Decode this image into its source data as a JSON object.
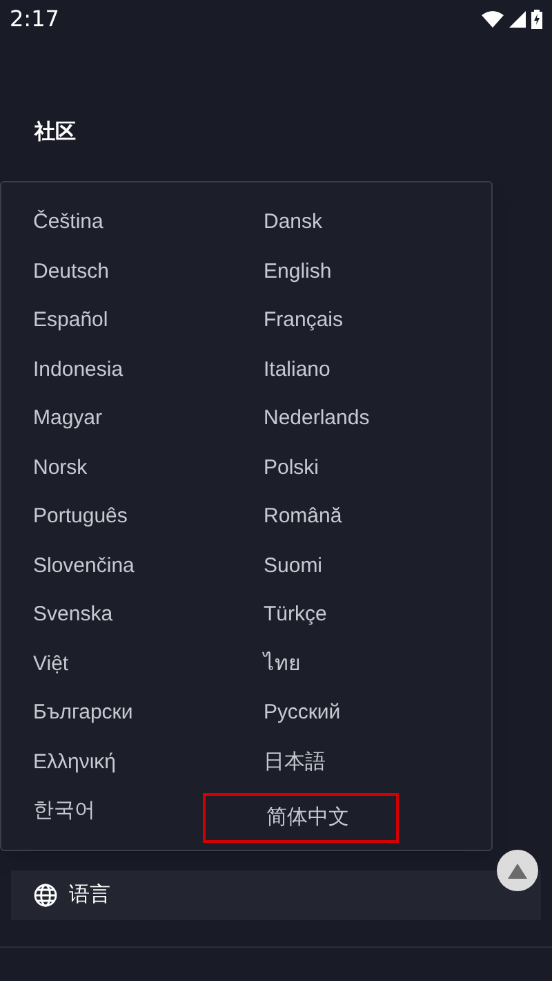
{
  "status_bar": {
    "time": "2:17"
  },
  "section": {
    "title": "社区"
  },
  "language_menu": {
    "options": [
      {
        "label": "Čeština",
        "selected": false
      },
      {
        "label": "Dansk",
        "selected": false
      },
      {
        "label": "Deutsch",
        "selected": false
      },
      {
        "label": "English",
        "selected": false
      },
      {
        "label": "Español",
        "selected": false
      },
      {
        "label": "Français",
        "selected": false
      },
      {
        "label": "Indonesia",
        "selected": false
      },
      {
        "label": "Italiano",
        "selected": false
      },
      {
        "label": "Magyar",
        "selected": false
      },
      {
        "label": "Nederlands",
        "selected": false
      },
      {
        "label": "Norsk",
        "selected": false
      },
      {
        "label": "Polski",
        "selected": false
      },
      {
        "label": "Português",
        "selected": false
      },
      {
        "label": "Română",
        "selected": false
      },
      {
        "label": "Slovenčina",
        "selected": false
      },
      {
        "label": "Suomi",
        "selected": false
      },
      {
        "label": "Svenska",
        "selected": false
      },
      {
        "label": "Türkçe",
        "selected": false
      },
      {
        "label": "Việt",
        "selected": false
      },
      {
        "label": "ไทย",
        "selected": false
      },
      {
        "label": "Български",
        "selected": false
      },
      {
        "label": "Русский",
        "selected": false
      },
      {
        "label": "Ελληνική",
        "selected": false
      },
      {
        "label": "日本語",
        "selected": false
      },
      {
        "label": "한국어",
        "selected": false
      },
      {
        "label": "简体中文",
        "selected": true
      }
    ]
  },
  "language_button": {
    "label": "语言"
  }
}
